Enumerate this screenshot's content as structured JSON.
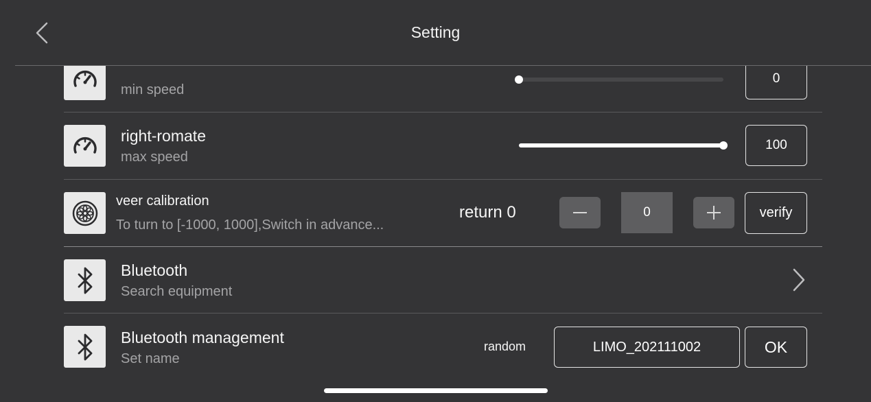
{
  "header": {
    "title": "Setting",
    "back_icon": "chevron-left-icon"
  },
  "rows": {
    "min_speed_row": {
      "icon": "speedometer-icon",
      "sub": "min speed",
      "slider_value": 0,
      "slider_min": 0,
      "slider_max": 100,
      "value": "0"
    },
    "right_romate": {
      "icon": "speedometer-icon",
      "title": "right-romate",
      "sub": "max speed",
      "slider_value": 100,
      "slider_min": 0,
      "slider_max": 100,
      "value": "100"
    },
    "veer_calibration": {
      "icon": "wheel-icon",
      "title": "veer calibration",
      "sub": "To turn to [-1000, 1000],Switch in advance...",
      "return_label": "return 0",
      "minus_icon": "minus-icon",
      "value": "0",
      "plus_icon": "plus-icon",
      "verify_label": "verify"
    },
    "bluetooth": {
      "icon": "bluetooth-icon",
      "title": "Bluetooth",
      "sub": "Search equipment",
      "chevron_icon": "chevron-right-icon"
    },
    "bluetooth_management": {
      "icon": "bluetooth-icon",
      "title": "Bluetooth management",
      "sub": "Set name",
      "random_label": "random",
      "name_value": "LIMO_202111002",
      "ok_label": "OK"
    }
  },
  "colors": {
    "background": "#343436",
    "tile": "#e9e9e9",
    "stepper": "#5e5e60",
    "track": "#474749"
  }
}
